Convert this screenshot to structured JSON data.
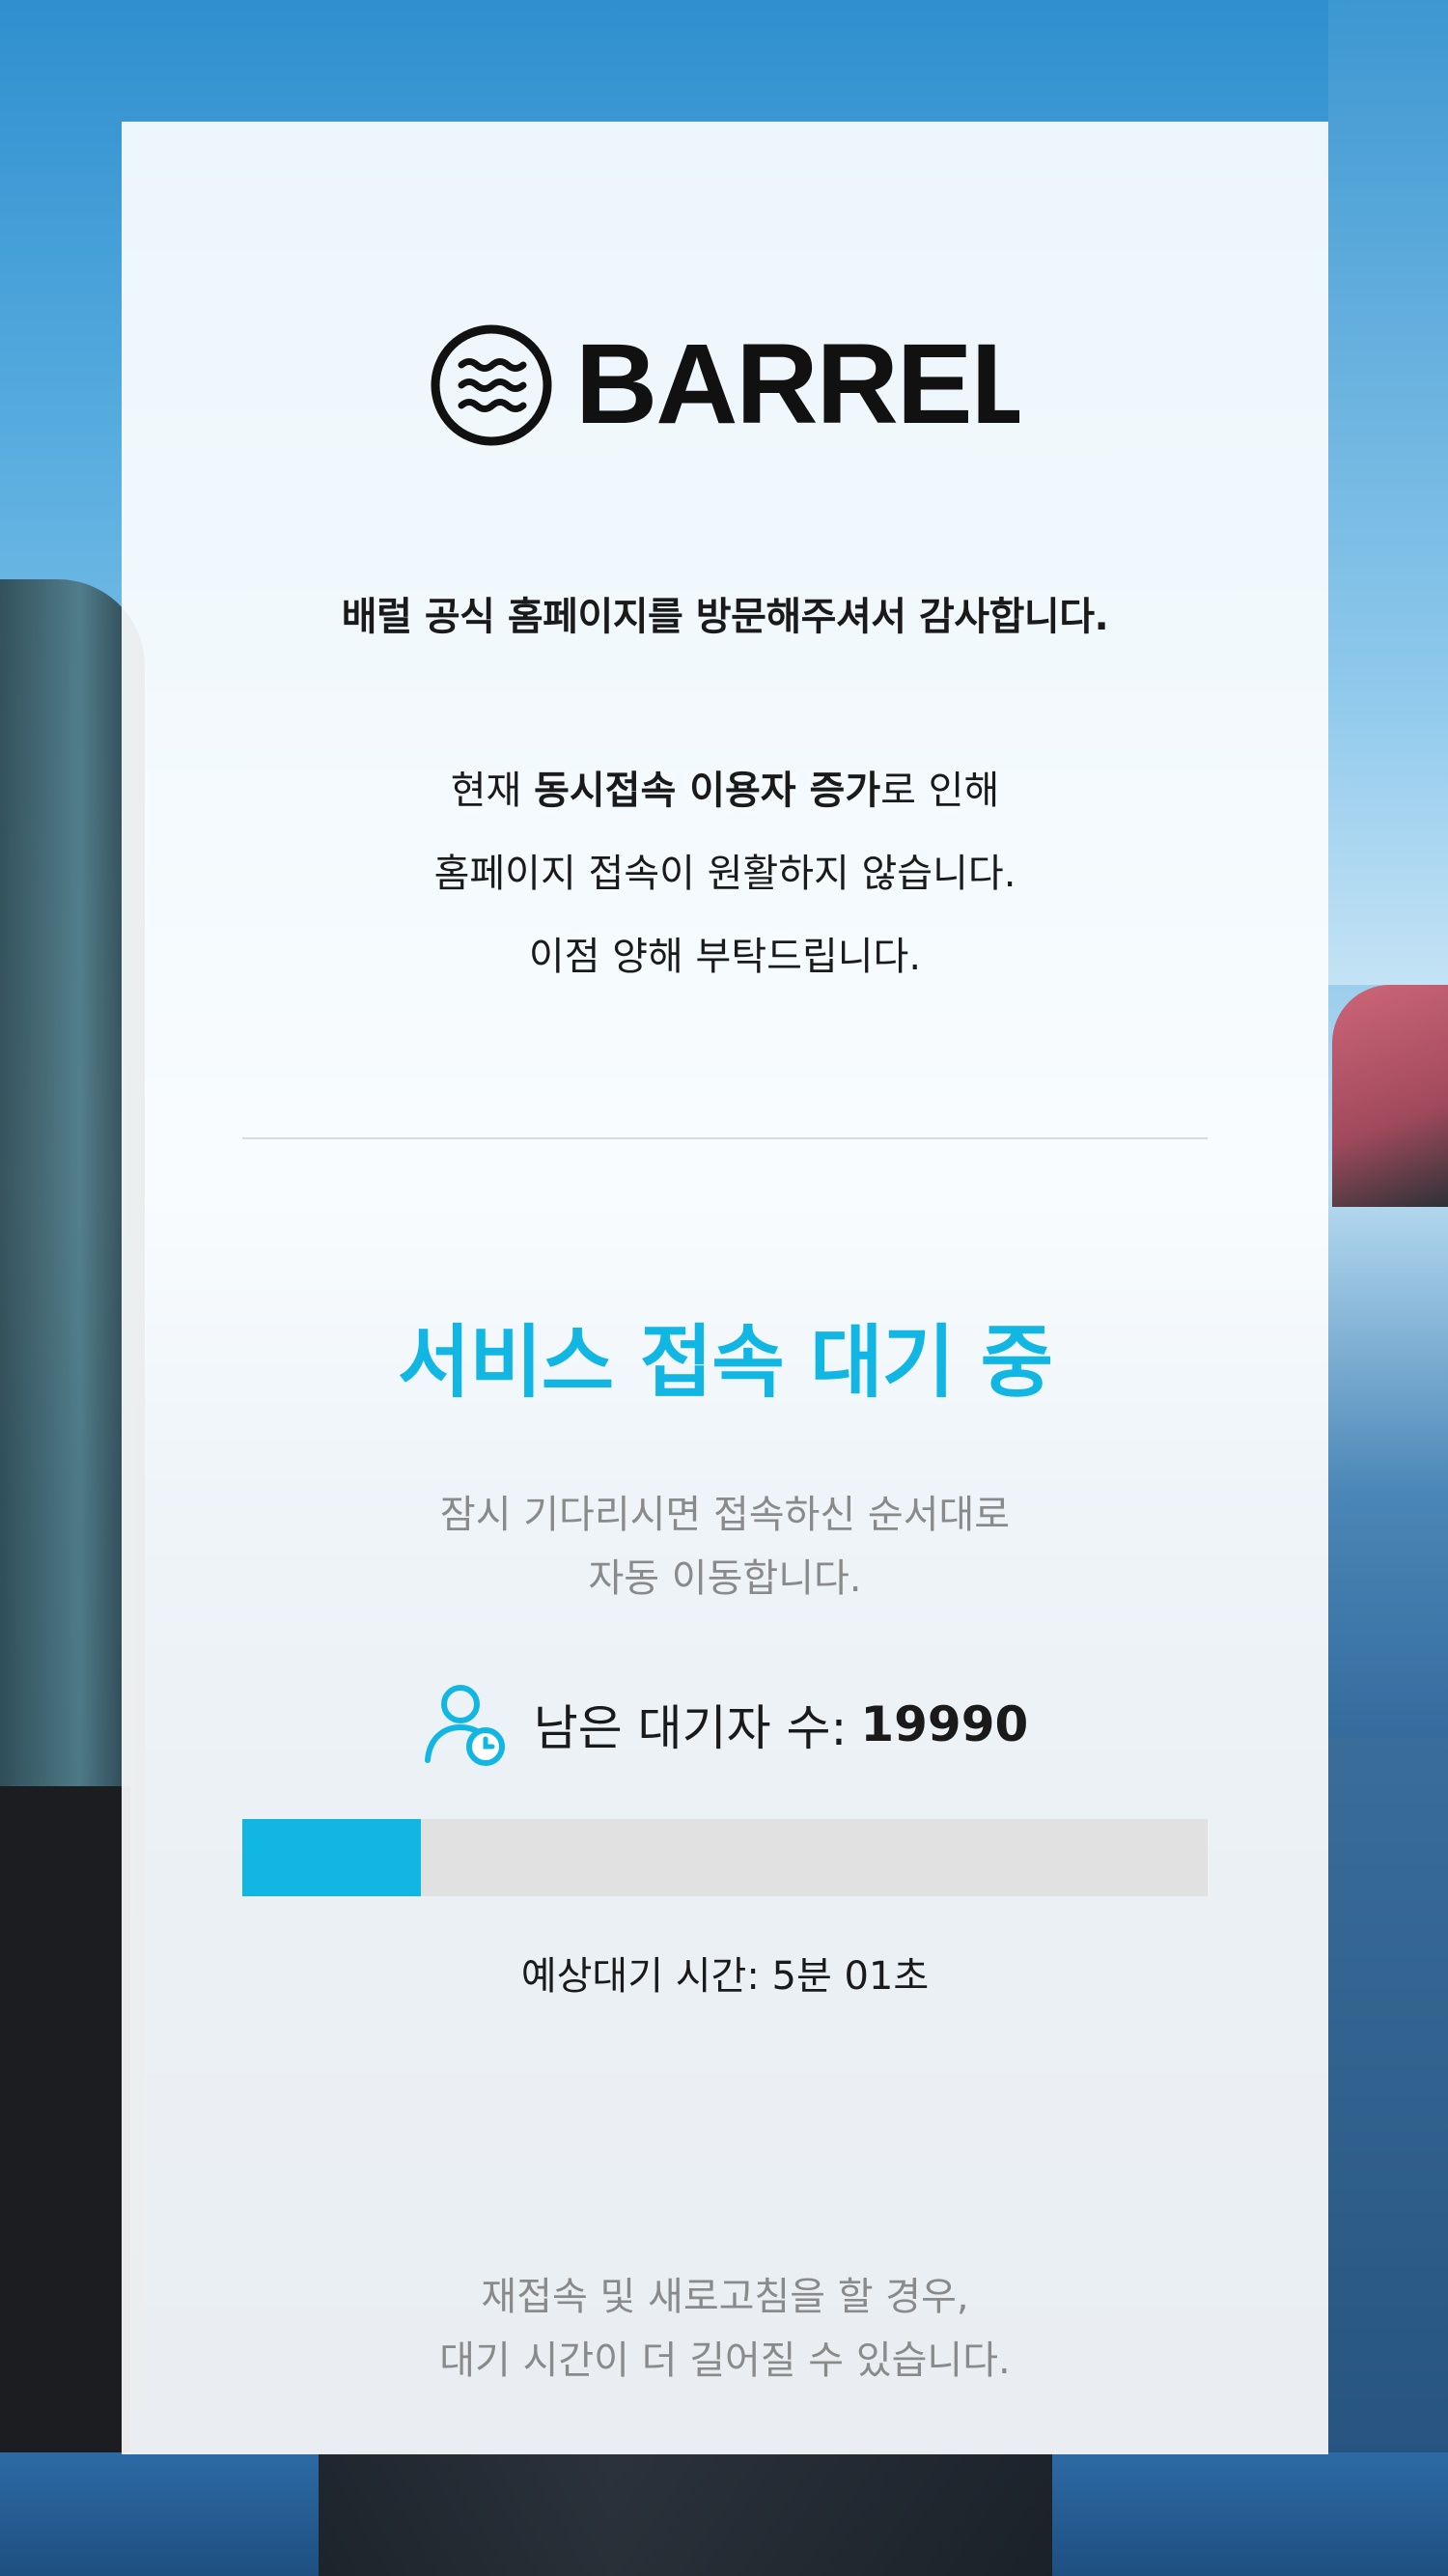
{
  "brand": {
    "name": "BARREL",
    "logo_icon": "wave-circle-icon"
  },
  "intro": {
    "thanks": "배럴 공식 홈페이지를 방문해주셔서 감사합니다.",
    "notice_line1_prefix": "현재 ",
    "notice_line1_bold": "동시접속 이용자 증가",
    "notice_line1_suffix": "로 인해",
    "notice_line2": "홈페이지 접속이 원활하지 않습니다.",
    "notice_line3": "이점 양해 부탁드립니다."
  },
  "queue": {
    "title": "서비스 접속 대기 중",
    "desc_line1": "잠시 기다리시면 접속하신 순서대로",
    "desc_line2": "자동 이동합니다.",
    "remaining_icon": "user-clock-icon",
    "remaining_label": "남은 대기자 수:",
    "remaining_count": "19990",
    "progress_fraction": 0.185,
    "eta": "예상대기 시간: 5분 01초",
    "warning_line1": "재접속 및 새로고침을 할 경우,",
    "warning_line2": "대기 시간이 더 길어질 수 있습니다."
  },
  "colors": {
    "accent": "#11b6e3",
    "text": "#1a1a1a",
    "muted": "#8a8a8a",
    "track": "#e1e1e1"
  }
}
